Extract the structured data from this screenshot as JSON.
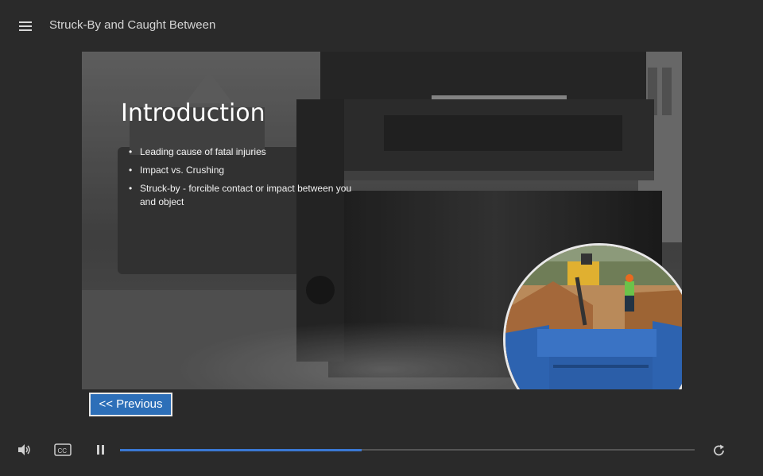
{
  "header": {
    "title": "Struck-By and Caught Between",
    "menu_icon": "hamburger-icon"
  },
  "slide": {
    "heading": "Introduction",
    "bullets": [
      "Leading cause of fatal injuries",
      "Impact vs. Crushing",
      "Struck-by - forcible contact or impact between you and object"
    ],
    "bullet_char": "•"
  },
  "navigation": {
    "previous_label": "<< Previous"
  },
  "player": {
    "volume_icon": "volume-icon",
    "captions_icon": "closed-captions-icon",
    "pause_icon": "pause-icon",
    "replay_icon": "replay-icon",
    "progress": 0.42,
    "accent_color": "#3a78d4"
  }
}
